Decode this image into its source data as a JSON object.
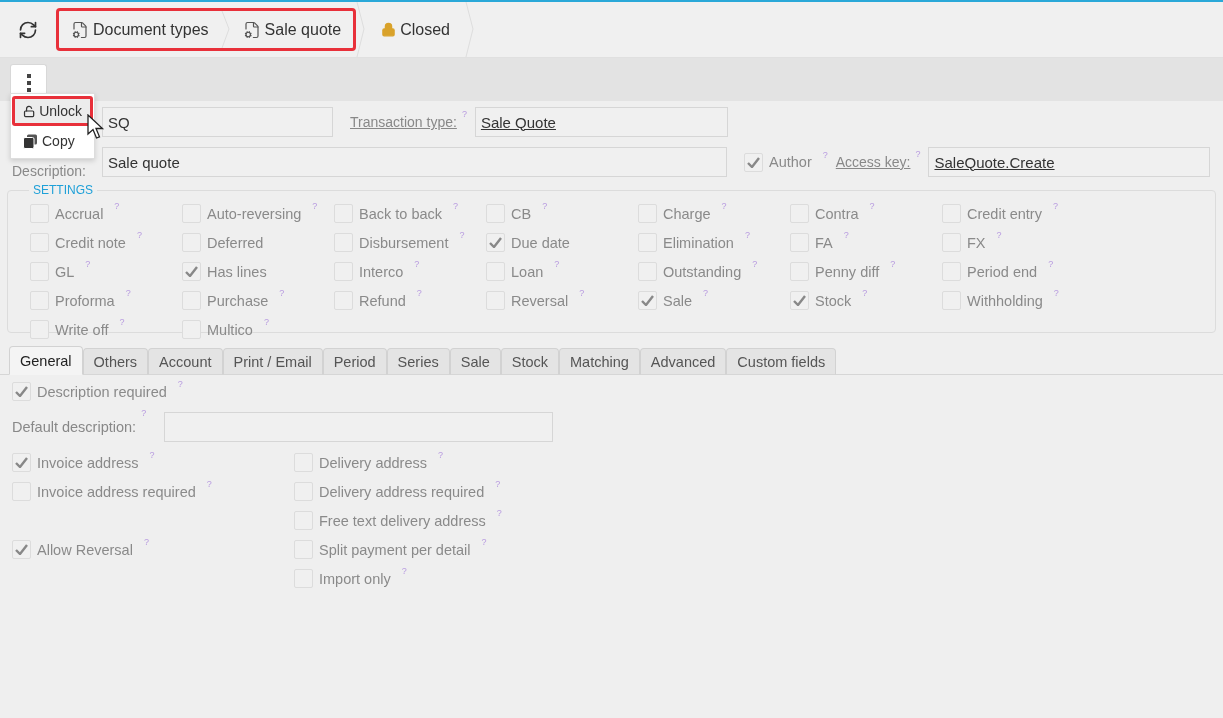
{
  "breadcrumb_groups": [
    {
      "highlighted": true,
      "items": [
        {
          "label": "Document types",
          "kind": "document"
        },
        {
          "label": "Sale quote",
          "kind": "document"
        }
      ]
    },
    {
      "highlighted": false,
      "items": [
        {
          "label": "Closed",
          "kind": "lock"
        }
      ]
    }
  ],
  "menu": [
    {
      "label": "Unlock",
      "kind": "unlock",
      "highlighted": true
    },
    {
      "label": "Copy",
      "kind": "copy",
      "highlighted": false
    }
  ],
  "form": {
    "code": {
      "value": "SQ"
    },
    "transaction_type": {
      "label": "Transaction type:",
      "help": "?",
      "value": "Sale Quote"
    },
    "description": {
      "label": "Description:",
      "value": "Sale quote"
    },
    "author": {
      "label": "Author",
      "help": "?",
      "checked": true
    },
    "access_key": {
      "label": "Access key:",
      "help": "?",
      "value": "SaleQuote.Create"
    }
  },
  "settings": {
    "title": "SETTINGS",
    "items": [
      {
        "label": "Accrual",
        "help": "?",
        "checked": false
      },
      {
        "label": "Auto-reversing",
        "help": "?",
        "checked": false
      },
      {
        "label": "Back to back",
        "help": "?",
        "checked": false
      },
      {
        "label": "CB",
        "help": "?",
        "checked": false
      },
      {
        "label": "Charge",
        "help": "?",
        "checked": false
      },
      {
        "label": "Contra",
        "help": "?",
        "checked": false
      },
      {
        "label": "Credit entry",
        "help": "?",
        "checked": false
      },
      {
        "label": "Credit note",
        "help": "?",
        "checked": false
      },
      {
        "label": "Deferred",
        "checked": false
      },
      {
        "label": "Disbursement",
        "help": "?",
        "checked": false
      },
      {
        "label": "Due date",
        "checked": true
      },
      {
        "label": "Elimination",
        "help": "?",
        "checked": false
      },
      {
        "label": "FA",
        "help": "?",
        "checked": false
      },
      {
        "label": "FX",
        "help": "?",
        "checked": false
      },
      {
        "label": "GL",
        "help": "?",
        "checked": false
      },
      {
        "label": "Has lines",
        "checked": true
      },
      {
        "label": "Interco",
        "help": "?",
        "checked": false
      },
      {
        "label": "Loan",
        "help": "?",
        "checked": false
      },
      {
        "label": "Outstanding",
        "help": "?",
        "checked": false
      },
      {
        "label": "Penny diff",
        "help": "?",
        "checked": false
      },
      {
        "label": "Period end",
        "help": "?",
        "checked": false
      },
      {
        "label": "Proforma",
        "help": "?",
        "checked": false
      },
      {
        "label": "Purchase",
        "help": "?",
        "checked": false
      },
      {
        "label": "Refund",
        "help": "?",
        "checked": false
      },
      {
        "label": "Reversal",
        "help": "?",
        "checked": false
      },
      {
        "label": "Sale",
        "help": "?",
        "checked": true
      },
      {
        "label": "Stock",
        "help": "?",
        "checked": true
      },
      {
        "label": "Withholding",
        "help": "?",
        "checked": false
      },
      {
        "label": "Write off",
        "help": "?",
        "checked": false
      },
      {
        "label": "Multico",
        "help": "?",
        "checked": false
      }
    ]
  },
  "tabs": [
    {
      "label": "General",
      "selected": true
    },
    {
      "label": "Others",
      "selected": false
    },
    {
      "label": "Account",
      "selected": false
    },
    {
      "label": "Print / Email",
      "selected": false
    },
    {
      "label": "Period",
      "selected": false
    },
    {
      "label": "Series",
      "selected": false
    },
    {
      "label": "Sale",
      "selected": false
    },
    {
      "label": "Stock",
      "selected": false
    },
    {
      "label": "Matching",
      "selected": false
    },
    {
      "label": "Advanced",
      "selected": false
    },
    {
      "label": "Custom fields",
      "selected": false
    }
  ],
  "general": {
    "description_required": {
      "label": "Description required",
      "help": "?",
      "checked": true
    },
    "default_description": {
      "label": "Default description:",
      "help": "?"
    },
    "left": [
      {
        "label": "Invoice address",
        "help": "?",
        "checked": true
      },
      {
        "label": "Invoice address required",
        "help": "?",
        "checked": false
      },
      {
        "label": "Allow Reversal",
        "help": "?",
        "checked": true
      }
    ],
    "right": [
      {
        "label": "Delivery address",
        "help": "?",
        "checked": false
      },
      {
        "label": "Delivery address required",
        "help": "?",
        "checked": false
      },
      {
        "label": "Free text delivery address",
        "help": "?",
        "checked": false
      },
      {
        "label": "Split payment per detail",
        "help": "?",
        "checked": false
      },
      {
        "label": "Import only",
        "help": "?",
        "checked": false
      }
    ]
  }
}
